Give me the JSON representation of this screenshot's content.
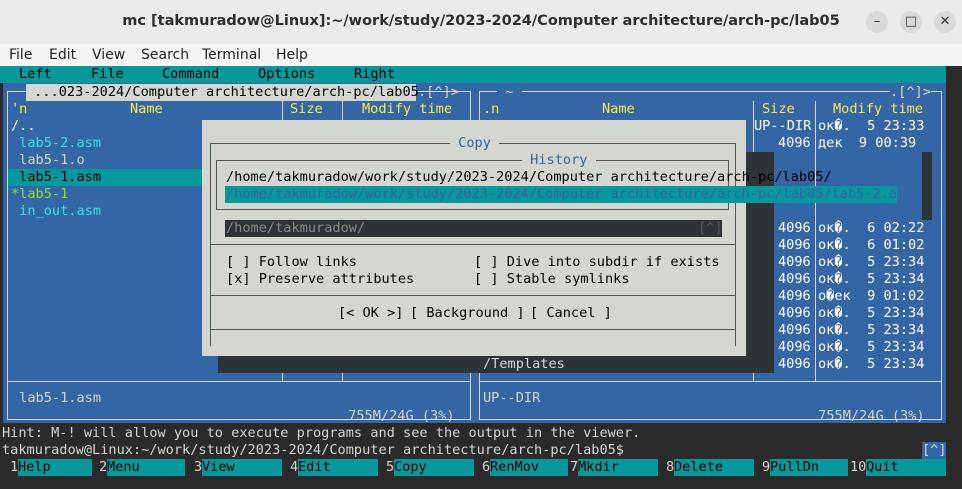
{
  "window": {
    "title": "mc [takmuradow@Linux]:~/work/study/2023-2024/Computer architecture/arch-pc/lab05",
    "minimize": "–",
    "maximize": "□",
    "close": "✕"
  },
  "terminal_menu": [
    "File",
    "Edit",
    "View",
    "Search",
    "Terminal",
    "Help"
  ],
  "mc_menu": [
    "Left",
    "File",
    "Command",
    "Options",
    "Right"
  ],
  "left_panel": {
    "path": " ...023-2024/Computer architecture/arch-pc/lab05 ",
    "path_ctrl": ".[^]>",
    "col_n": "'n",
    "col_name": "Name",
    "col_size": "Size",
    "col_mtime": "Modify time",
    "files": [
      {
        "name": "/..",
        "style": "dir"
      },
      {
        "name": " lab5-2.asm",
        "style": "cyan"
      },
      {
        "name": " lab5-1.o",
        "style": "normal"
      },
      {
        "name": " lab5-1.asm",
        "style": "selected"
      },
      {
        "name": "*lab5-1",
        "style": "exec"
      },
      {
        "name": " in_out.asm",
        "style": "cyan"
      }
    ],
    "status": " lab5-1.asm",
    "disk": " 755M/24G (3%) "
  },
  "right_panel": {
    "path": " ~ ",
    "path_ctrl": ".[^]>",
    "col_n": ".n",
    "col_name": "Name",
    "col_size": "Size",
    "col_mtime": "Modify time",
    "rows": [
      {
        "size": "UP--DIR",
        "date": "ок�.  5 23:33"
      },
      {
        "size": "4096",
        "date": "дек  9 00:39"
      },
      {
        "size": "",
        "date": ""
      },
      {
        "size": "",
        "date": ""
      },
      {
        "size": "",
        "date": ""
      },
      {
        "size": "",
        "date": ""
      },
      {
        "size": "4096",
        "date": "ок�.  6 02:22"
      },
      {
        "size": "4096",
        "date": "ок�.  6 01:02"
      },
      {
        "size": "4096",
        "date": "ок�.  5 23:34"
      },
      {
        "size": "4096",
        "date": "ок�.  5 23:34"
      },
      {
        "size": "4096",
        "date": "о�ек  9 01:02"
      },
      {
        "size": "4096",
        "date": "ок�.  5 23:34"
      },
      {
        "size": "4096",
        "date": "ок�.  5 23:34"
      },
      {
        "size": "4096",
        "date": "ок�.  5 23:34"
      },
      {
        "size": "4096",
        "date": "ок�.  5 23:34"
      }
    ],
    "templates": "/Templates",
    "status": "UP--DIR",
    "disk": " 755M/24G (3%) "
  },
  "copy_dialog": {
    "title": " Copy ",
    "history_title": " History ",
    "history": [
      "/home/takmuradow/work/study/2023-2024/Computer architecture/arch-pc/lab05/",
      "/home/takmuradow/work/study/2023-2024/Computer architecture/arch-pc/lab05/lab5-2.asm"
    ],
    "target": "/home/takmuradow/",
    "target_ctrl": "[^]",
    "follow_links": "[ ] Follow links",
    "dive_subdir": "[ ] Dive into subdir if exists",
    "preserve_attrs": "[x] Preserve attributes",
    "stable_symlinks": "[ ] Stable symlinks",
    "ok": "[< OK >]",
    "background": "[ Background ]",
    "cancel": "[ Cancel ]"
  },
  "hint": "Hint: M-! will allow you to execute programs and see the output in the viewer.",
  "prompt": "takmuradow@Linux:~/work/study/2023-2024/Computer architecture/arch-pc/lab05$",
  "prompt_ctrl": "[^]",
  "fkeys": [
    {
      "n": "1",
      "label": "Help"
    },
    {
      "n": "2",
      "label": "Menu"
    },
    {
      "n": "3",
      "label": "View"
    },
    {
      "n": "4",
      "label": "Edit"
    },
    {
      "n": "5",
      "label": "Copy"
    },
    {
      "n": "6",
      "label": "RenMov"
    },
    {
      "n": "7",
      "label": "Mkdir"
    },
    {
      "n": "8",
      "label": "Delete"
    },
    {
      "n": "9",
      "label": "PullDn"
    },
    {
      "n": "10",
      "label": "Quit"
    }
  ]
}
